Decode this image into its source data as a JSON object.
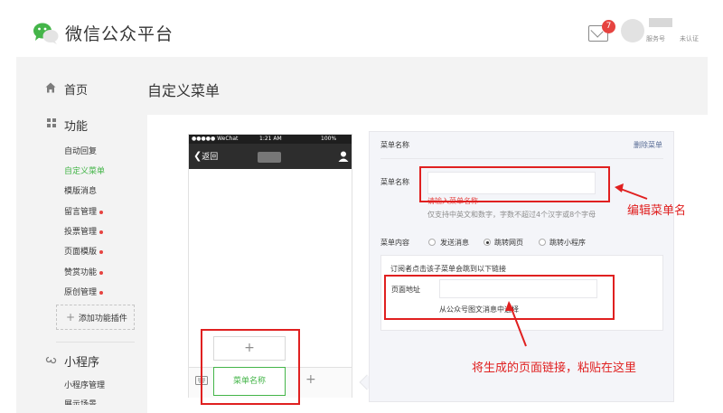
{
  "header": {
    "title": "微信公众平台",
    "mail_badge": "7",
    "account_type": "服务号",
    "account_status": "未认证"
  },
  "sidebar": {
    "home": "首页",
    "function": "功能",
    "sub_items": [
      {
        "label": "自动回复",
        "active": false,
        "dot": false
      },
      {
        "label": "自定义菜单",
        "active": true,
        "dot": false
      },
      {
        "label": "模版消息",
        "active": false,
        "dot": false
      },
      {
        "label": "留言管理",
        "active": false,
        "dot": true
      },
      {
        "label": "投票管理",
        "active": false,
        "dot": true
      },
      {
        "label": "页面模版",
        "active": false,
        "dot": true
      },
      {
        "label": "赞赏功能",
        "active": false,
        "dot": true
      },
      {
        "label": "原创管理",
        "active": false,
        "dot": true
      }
    ],
    "add_plugin": "添加功能插件",
    "mini_program": "小程序",
    "mini_sub": "小程序管理",
    "mini_sub2": "展示场景"
  },
  "page": {
    "title": "自定义菜单"
  },
  "phone": {
    "carrier": "●●●●● WeChat",
    "time": "1:21 AM",
    "battery": "100%",
    "back": "返回",
    "add_sub": "+",
    "menu_button": "菜单名称",
    "add_menu": "+"
  },
  "form": {
    "header": "菜单名称",
    "delete": "删除菜单",
    "name_label": "菜单名称",
    "error": "请输入菜单名称",
    "hint": "仅支持中英文和数字，字数不超过4个汉字或8个字母",
    "content_label": "菜单内容",
    "options": [
      "发送消息",
      "跳转网页",
      "跳转小程序"
    ],
    "selected_option": "跳转网页",
    "inner_hint": "订阅者点击该子菜单会跳到以下链接",
    "url_label": "页面地址",
    "url_sub": "从公众号图文消息中选择"
  },
  "annotations": {
    "edit_name": "编辑菜单名",
    "paste_link": "将生成的页面链接，粘贴在这里"
  }
}
